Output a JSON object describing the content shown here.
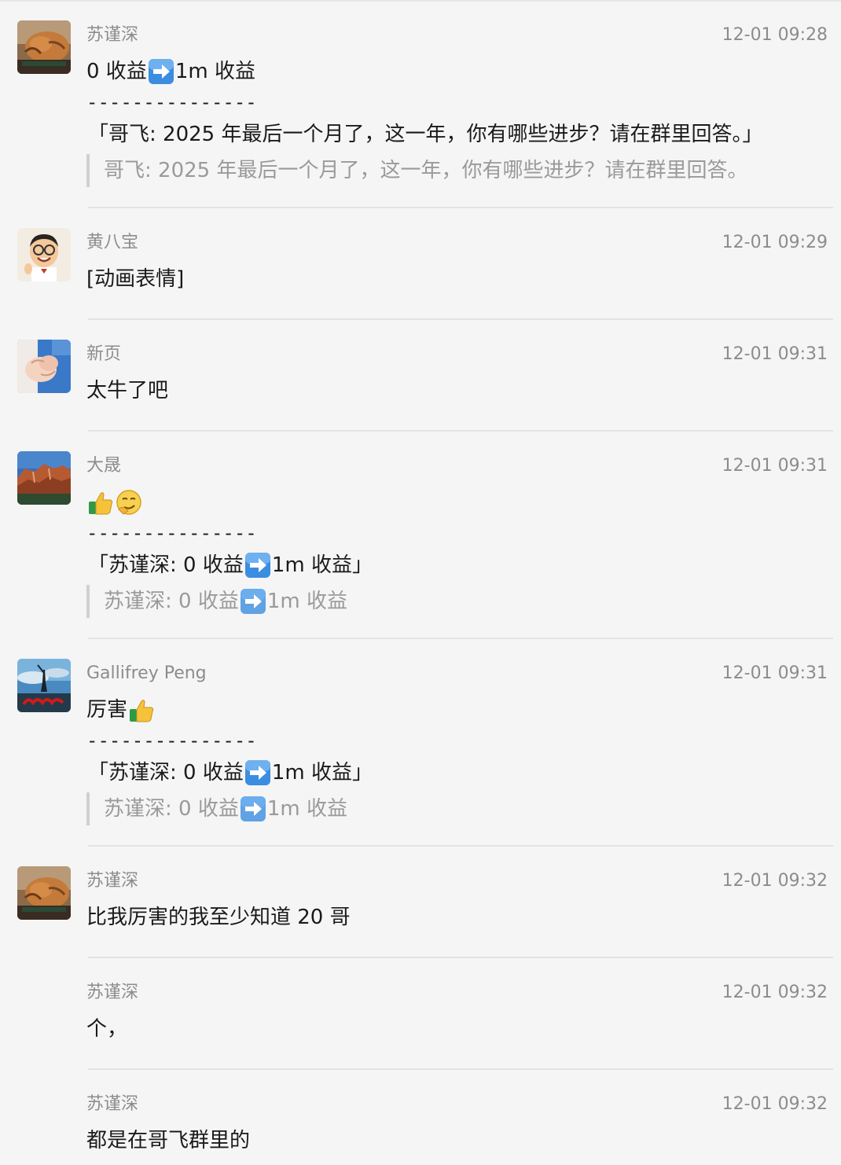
{
  "messages": [
    {
      "sender": "苏谨深",
      "time": "12-01 09:28",
      "avatar": "cat-avatar",
      "text_before": "0 收益",
      "text_after": "1m 收益",
      "divider": "---------------",
      "quote": "「哥飞: 2025 年最后一个月了，这一年，你有哪些进步？请在群里回答。」",
      "reference": "哥飞: 2025 年最后一个月了，这一年，你有哪些进步？请在群里回答。"
    },
    {
      "sender": "黄八宝",
      "time": "12-01 09:29",
      "avatar": "cartoon-man-avatar",
      "text": "[动画表情]"
    },
    {
      "sender": "新页",
      "time": "12-01 09:31",
      "avatar": "holding-hands-avatar",
      "text": "太牛了吧"
    },
    {
      "sender": "大晟",
      "time": "12-01 09:31",
      "avatar": "canyon-landscape-avatar",
      "divider": "---------------",
      "quote_prefix": "「苏谨深: 0 收益",
      "quote_suffix": "1m 收益」",
      "ref_prefix": "苏谨深: 0 收益",
      "ref_suffix": "1m 收益"
    },
    {
      "sender": "Gallifrey  Peng",
      "time": "12-01 09:31",
      "avatar": "2025-sky-avatar",
      "text": "厉害",
      "divider": "---------------",
      "quote_prefix": "「苏谨深: 0 收益",
      "quote_suffix": "1m 收益」",
      "ref_prefix": "苏谨深: 0 收益",
      "ref_suffix": "1m 收益"
    },
    {
      "sender": "苏谨深",
      "time": "12-01 09:32",
      "avatar": "cat-avatar",
      "text": "比我厉害的我至少知道 20 哥"
    },
    {
      "sender": "苏谨深",
      "time": "12-01 09:32",
      "text": "个，"
    },
    {
      "sender": "苏谨深",
      "time": "12-01 09:32",
      "text": "都是在哥飞群里的"
    }
  ],
  "colors": {
    "background": "#f5f5f5",
    "meta_text": "#8c8c8c",
    "reference_text": "#9a9a9a",
    "arrow_emoji": "#3b8de0"
  }
}
